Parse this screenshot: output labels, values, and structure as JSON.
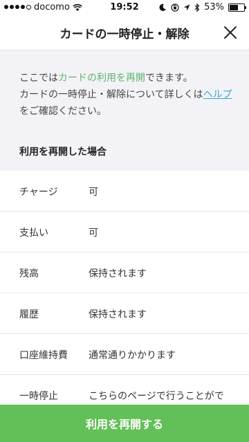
{
  "status_bar": {
    "carrier": "docomo",
    "time": "19:52",
    "battery": "53%",
    "battery_level": 0.53
  },
  "nav": {
    "title": "カードの一時停止・解除"
  },
  "intro": {
    "line1_a": "ここでは",
    "line1_b": "カードの利用を再開",
    "line1_c": "できます。",
    "line2_a": "カードの一時停止・解除について詳しくは",
    "line2_link": "ヘルプ",
    "line2_b": "をご確認ください。"
  },
  "section_header": "利用を再開した場合",
  "rows": [
    {
      "label": "チャージ",
      "value": "可"
    },
    {
      "label": "支払い",
      "value": "可"
    },
    {
      "label": "残高",
      "value": "保持されます"
    },
    {
      "label": "履歴",
      "value": "保持されます"
    },
    {
      "label": "口座維持費",
      "value": "通常通りかかります"
    },
    {
      "label": "一時停止",
      "value": "こちらのページで行うことがで"
    }
  ],
  "action_button": "利用を再開する"
}
